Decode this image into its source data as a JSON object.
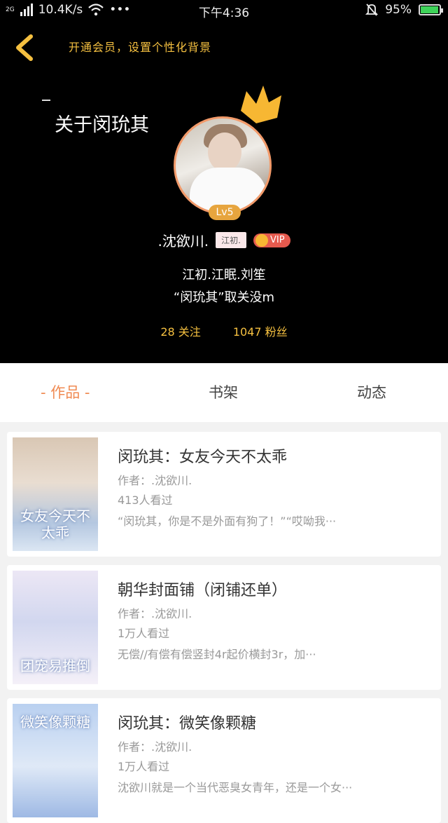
{
  "status_bar": {
    "network": "2G",
    "speed": "10.4K/s",
    "more": "•••",
    "time": "下午4:36",
    "battery": "95%",
    "battery_level": 0.95
  },
  "header": {
    "vip_promo": "开通会员，设置个性化背景",
    "about_title": "关于闵玧其",
    "level": "Lv5",
    "name": ".沈欲川.",
    "tag": "江初.",
    "vip": "VIP",
    "bio_line1": "江初.江眠.刘笙",
    "bio_line2": "“闵玧其”取关没m",
    "following": "28 关注",
    "followers": "1047 粉丝",
    "accent_color": "#f5c040"
  },
  "tabs": [
    {
      "label": "- 作品 -",
      "active": true
    },
    {
      "label": "书架",
      "active": false
    },
    {
      "label": "动态",
      "active": false
    }
  ],
  "works": [
    {
      "title": "闵玧其：女友今天不太乖",
      "author": "作者：.沈欲川.",
      "views": "413人看过",
      "desc": "“闵玧其，你是不是外面有狗了！”“哎呦我···",
      "cover_text": "女友今天不太乖"
    },
    {
      "title": "朝华封面铺（闭铺还单）",
      "author": "作者：.沈欲川.",
      "views": "1万人看过",
      "desc": "无偿//有偿有偿竖封4r起价横封3r，加···",
      "cover_text": "团宠易推倒"
    },
    {
      "title": "闵玧其：微笑像颗糖",
      "author": "作者：.沈欲川.",
      "views": "1万人看过",
      "desc": "沈欲川就是一个当代恶臭女青年，还是一个女···",
      "cover_text": "微笑像颗糖"
    }
  ]
}
